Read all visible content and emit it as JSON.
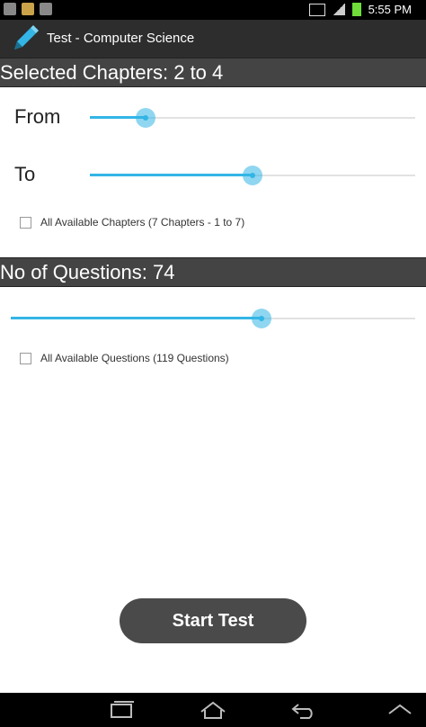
{
  "status_bar": {
    "time": "5:55 PM"
  },
  "app_bar": {
    "title": "Test - Computer Science"
  },
  "chapters": {
    "header": "Selected Chapters: 2 to 4",
    "from_label": "From",
    "to_label": "To",
    "from_level": 0.17,
    "to_level": 0.5,
    "all_label": "All Available Chapters (7 Chapters - 1 to 7)"
  },
  "questions": {
    "header": "No of Questions: 74",
    "level": 0.62,
    "all_label": "All Available Questions (119 Questions)"
  },
  "start_button": {
    "label": "Start Test"
  },
  "colors": {
    "accent": "#33b5e5",
    "header_bg": "#444444",
    "appbar_bg": "#2d2d2d",
    "button_bg": "#4a4a4a"
  },
  "icons": [
    "gallery-icon",
    "android-icon",
    "file-icon",
    "nfc-icon",
    "signal-icon",
    "battery-icon",
    "pencil-icon",
    "recent-apps-icon",
    "home-icon",
    "back-icon",
    "up-icon"
  ]
}
